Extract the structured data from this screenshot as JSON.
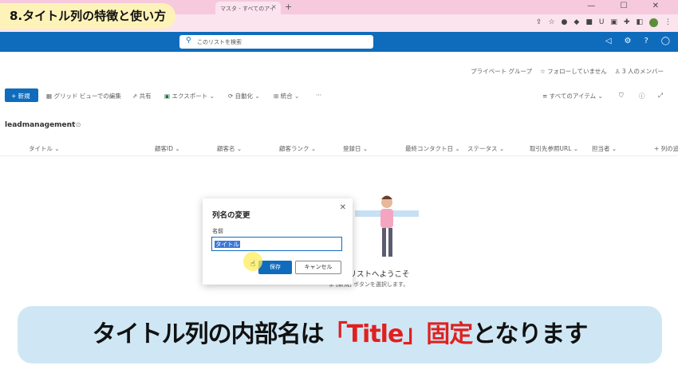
{
  "browser": {
    "tab_title": "マスタ - すべてのアイ",
    "tab_close": "×",
    "new_tab": "+",
    "window_controls": "— ☐ ✕"
  },
  "banner": {
    "title": "8.タイトル列の特徴と使い方"
  },
  "sharepoint": {
    "search_placeholder": "このリストを検索",
    "site_header": {
      "private_group": "プライベート グループ",
      "follow": "☆ フォローしていません",
      "members": "3 人のメンバー"
    }
  },
  "command_bar": {
    "new": "+ 新規",
    "grid_edit": "グリッド ビューでの編集",
    "share": "共有",
    "export": "エクスポート",
    "automate": "自動化",
    "integrate": "統合",
    "more": "···",
    "view": "すべてのアイテム"
  },
  "list": {
    "name": "leadmanagement",
    "columns": [
      "タイトル",
      "顧客ID",
      "顧客名",
      "顧客ランク",
      "登録日",
      "最終コンタクト日",
      "ステータス",
      "取引先参照URL",
      "担当者",
      "+ 列の追"
    ]
  },
  "empty_state": {
    "title": "いリストへようこそ",
    "subtitle": "ま [新規] ボタンを選択します。"
  },
  "dialog": {
    "title": "列名の変更",
    "label": "名前",
    "value": "タイトル",
    "save": "保存",
    "cancel": "キャンセル",
    "close": "✕"
  },
  "caption": {
    "part1": "タイトル列の内部名は",
    "highlight": "「Title」固定",
    "part2": "となります"
  },
  "colors": {
    "accent": "#0f6cbd",
    "caption_bg": "#cfe7f4",
    "highlight_red": "#e02020",
    "banner_bg": "#fdf3b8"
  }
}
